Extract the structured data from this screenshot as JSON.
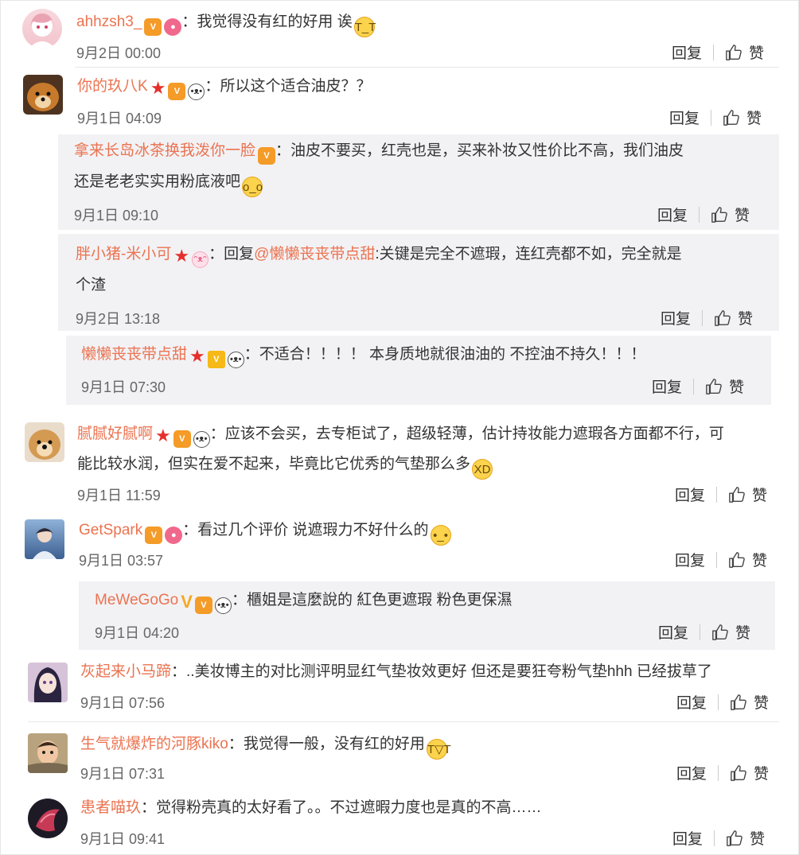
{
  "actions": {
    "reply": "回复",
    "like": "赞"
  },
  "comments": [
    {
      "name": "ahhzsh3_",
      "text": "我觉得没有红的好用 诶",
      "time": "9月2日 00:00"
    },
    {
      "name": "你的玖八K",
      "text": "所以这个适合油皮？？",
      "time": "9月1日 04:09"
    },
    {
      "name": "拿来长岛冰茶换我泼你一脸",
      "text1": "油皮不要买，红壳也是，买来补妆又性价比不高，我们油皮",
      "text2": "还是老老实实用粉底液吧",
      "time": "9月1日 09:10"
    },
    {
      "name": "胖小猪-米小可",
      "reply_prefix": "回复",
      "mention": "@懒懒丧丧带点甜",
      "text1": ":关键是完全不遮瑕，连红壳都不如，完全就是",
      "text2": "个渣",
      "time": "9月2日 13:18"
    },
    {
      "name": "懒懒丧丧带点甜",
      "text": "不适合！！！！ 本身质地就很油油的 不控油不持久！！！",
      "time": "9月1日 07:30"
    },
    {
      "name": "腻腻好腻啊",
      "text1": "应该不会买，去专柜试了，超级轻薄，估计持妆能力遮瑕各方面都不行，可",
      "text2": "能比较水润，但实在爱不起来，毕竟比它优秀的气垫那么多",
      "time": "9月1日 11:59"
    },
    {
      "name": "GetSpark",
      "text": "看过几个评价 说遮瑕力不好什么的",
      "time": "9月1日 03:57"
    },
    {
      "name": "MeWeGoGo",
      "text": "櫃姐是這麼說的 紅色更遮瑕 粉色更保濕",
      "time": "9月1日 04:20"
    },
    {
      "name": "灰起来小马蹄",
      "text": "..美妆博主的对比测评明显红气垫妆效更好 但还是要狂夸粉气垫hhh 已经拔草了",
      "time": "9月1日 07:56"
    },
    {
      "name": "生气就爆炸的河豚kiko",
      "text": "我觉得一般，没有红的好用",
      "time": "9月1日 07:31"
    },
    {
      "name": "患者喵玖",
      "text": "觉得粉壳真的太好看了。。不过遮暇力度也是真的不高……",
      "time": "9月1日 09:41"
    }
  ]
}
